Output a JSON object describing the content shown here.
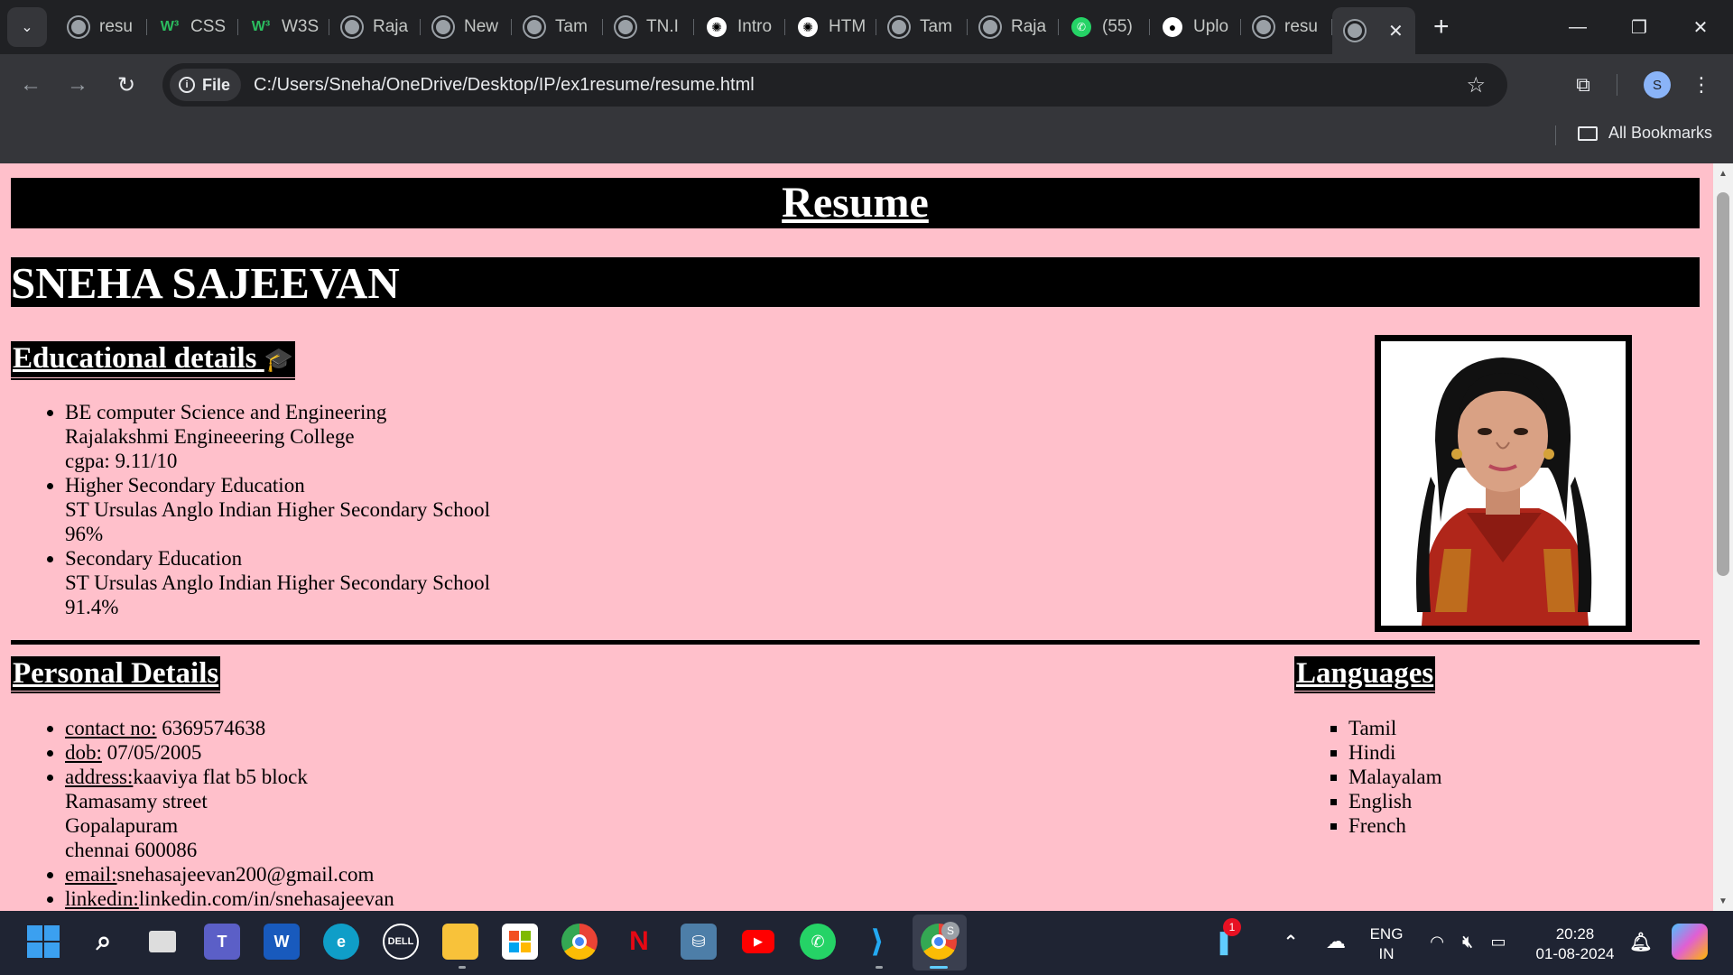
{
  "browser": {
    "tabs": [
      {
        "label": "resu",
        "favicon": "globe-icon"
      },
      {
        "label": "CSS",
        "favicon": "w3schools-icon"
      },
      {
        "label": "W3S",
        "favicon": "w3schools-icon"
      },
      {
        "label": "Raja",
        "favicon": "globe-icon"
      },
      {
        "label": "New",
        "favicon": "shield-globe-icon"
      },
      {
        "label": "Tam",
        "favicon": "globe-icon"
      },
      {
        "label": "TN.I",
        "favicon": "globe-icon"
      },
      {
        "label": "Intro",
        "favicon": "chatgpt-icon"
      },
      {
        "label": "HTM",
        "favicon": "chatgpt-icon"
      },
      {
        "label": "Tam",
        "favicon": "globe-icon"
      },
      {
        "label": "Raja",
        "favicon": "globe-icon"
      },
      {
        "label": "(55)",
        "favicon": "whatsapp-icon"
      },
      {
        "label": "Uplo",
        "favicon": "github-icon"
      },
      {
        "label": "resu",
        "favicon": "globe-icon"
      }
    ],
    "site_chip": "File",
    "url": "C:/Users/Sneha/OneDrive/Desktop/IP/ex1resume/resume.html",
    "profile_initial": "S",
    "bookmarks_label": "All Bookmarks"
  },
  "resume": {
    "title": "Resume",
    "name": "SNEHA SAJEEVAN",
    "education_heading": "Educational details",
    "education_emoji": "🎓",
    "education": [
      {
        "degree": "BE computer Science and Engineering",
        "institution": "Rajalakshmi Engineeering College",
        "score": "cgpa: 9.11/10"
      },
      {
        "degree": "Higher Secondary Education",
        "institution": "ST Ursulas Anglo Indian Higher Secondary School",
        "score": "96%"
      },
      {
        "degree": "Secondary Education",
        "institution": "ST Ursulas Anglo Indian Higher Secondary School",
        "score": "91.4%"
      }
    ],
    "personal_heading": "Personal Details",
    "personal": {
      "contact_label": "contact no:",
      "contact_value": " 6369574638",
      "dob_label": "dob:",
      "dob_value": " 07/05/2005",
      "address_label": "address:",
      "address_lines": [
        "kaaviya flat b5 block",
        "Ramasamy street",
        "Gopalapuram",
        "chennai 600086"
      ],
      "email_label": "email:",
      "email_value": "snehasajeevan200@gmail.com",
      "linkedin_label": "linkedin:",
      "linkedin_value": "linkedin.com/in/snehasajeevan"
    },
    "languages_heading": "Languages",
    "languages": [
      "Tamil",
      "Hindi",
      "Malayalam",
      "English",
      "French"
    ]
  },
  "taskbar": {
    "notification_count": "1",
    "lang_line1": "ENG",
    "lang_line2": "IN",
    "time": "20:28",
    "date": "01-08-2024",
    "chrome_profile_badge": "S"
  },
  "colors": {
    "page_background": "#ffc0cb",
    "heading_background": "#000000",
    "heading_text": "#ffffff",
    "browser_chrome": "#202124",
    "toolbar": "#35363a"
  }
}
